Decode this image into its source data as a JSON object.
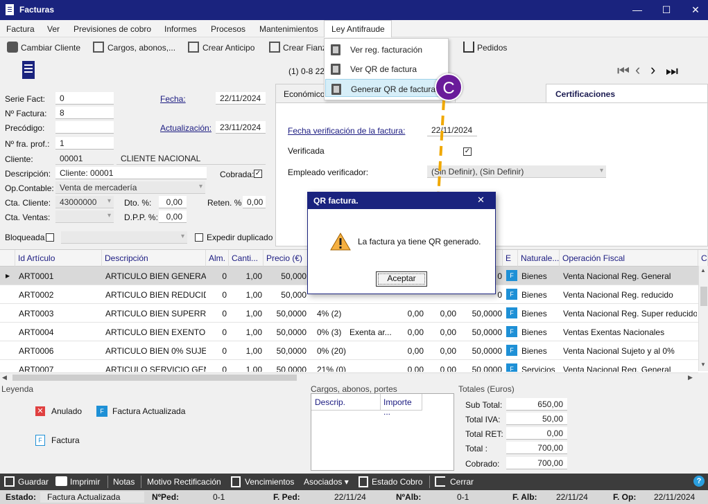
{
  "window": {
    "title": "Facturas",
    "minimize": "—",
    "maximize": "☐",
    "close": "✕"
  },
  "menu": [
    "Factura",
    "Ver",
    "Previsiones de cobro",
    "Informes",
    "Procesos",
    "Mantenimientos",
    "Ley Antifraude"
  ],
  "toolbar": {
    "cambiar_cliente": "Cambiar Cliente",
    "cargos": "Cargos, abonos,...",
    "crear_anticipo": "Crear Anticipo",
    "crear_fianza": "Crear Fianza",
    "pedidos": "Pedidos"
  },
  "dropdown": {
    "items": [
      "Ver reg. facturación",
      "Ver QR de factura",
      "Generar QR de factura"
    ]
  },
  "callout": "C",
  "nav_info": "(1) 0-8  22",
  "form": {
    "serie_label": "Serie Fact:",
    "serie": "0",
    "fecha_label": "Fecha:",
    "fecha": "22/11/2024",
    "nfactura_label": "Nº Factura:",
    "nfactura": "8",
    "actualizacion_label": "Actualización:",
    "actualizacion": "23/11/2024",
    "precodigo_label": "Precódigo:",
    "precodigo": "",
    "nfra_label": "Nº fra. prof.:",
    "nfra": "1",
    "cliente_label": "Cliente:",
    "cliente_code": "00001",
    "cliente_name": "CLIENTE NACIONAL",
    "descripcion_label": "Descripción:",
    "descripcion": "Cliente: 00001",
    "cobrada_label": "Cobrada:",
    "opcontable_label": "Op.Contable:",
    "opcontable": "Venta de mercadería",
    "ctacliente_label": "Cta. Cliente:",
    "ctacliente": "43000000",
    "dto_label": "Dto. %:",
    "dto": "0,00",
    "reten_label": "Reten. %",
    "reten": "0,00",
    "ctaventas_label": "Cta. Ventas:",
    "ctaventas": "",
    "dpp_label": "D.P.P. %:",
    "dpp": "0,00",
    "bloqueada_label": "Bloqueada",
    "expedir_label": "Expedir duplicado"
  },
  "tabs": {
    "economico": "Económico",
    "certificaciones": "Certificaciones"
  },
  "panel": {
    "fecha_verif_label": "Fecha verificación de la factura:",
    "fecha_verif": "22/11/2024",
    "verificada_label": "Verificada",
    "empleado_label": "Empleado verificador:",
    "empleado": "(Sin Definir), (Sin Definir)"
  },
  "grid": {
    "headers": [
      "Id Artículo",
      "Descripción",
      "Alm.",
      "Canti...",
      "Precio (€)",
      "E",
      "Naturale...",
      "Operación Fiscal",
      "C"
    ],
    "rows": [
      {
        "id": "ART0001",
        "desc": "ARTICULO BIEN GENERAL",
        "alm": "0",
        "cant": "1,00",
        "precio": "50,000",
        "iva": "",
        "exenta": "",
        "a": "",
        "b": "",
        "total": "0",
        "nat": "Bienes",
        "op": "Venta Nacional Reg. General"
      },
      {
        "id": "ART0002",
        "desc": "ARTICULO BIEN REDUCIDO",
        "alm": "0",
        "cant": "1,00",
        "precio": "50,000",
        "iva": "",
        "exenta": "",
        "a": "",
        "b": "",
        "total": "0",
        "nat": "Bienes",
        "op": "Venta Nacional Reg. reducido"
      },
      {
        "id": "ART0003",
        "desc": "ARTICULO BIEN SUPERR...",
        "alm": "0",
        "cant": "1,00",
        "precio": "50,0000",
        "iva": "4% (2)",
        "exenta": "",
        "a": "0,00",
        "b": "0,00",
        "total": "50,0000",
        "nat": "Bienes",
        "op": "Venta Nacional Reg. Super reducido"
      },
      {
        "id": "ART0004",
        "desc": "ARTICULO BIEN EXENTO",
        "alm": "0",
        "cant": "1,00",
        "precio": "50,0000",
        "iva": "0% (3)",
        "exenta": "Exenta ar...",
        "a": "0,00",
        "b": "0,00",
        "total": "50,0000",
        "nat": "Bienes",
        "op": "Ventas Exentas Nacionales"
      },
      {
        "id": "ART0006",
        "desc": "ARTICULO BIEN 0% SUJE...",
        "alm": "0",
        "cant": "1,00",
        "precio": "50,0000",
        "iva": "0% (20)",
        "exenta": "",
        "a": "0,00",
        "b": "0,00",
        "total": "50,0000",
        "nat": "Bienes",
        "op": "Venta Nacional Sujeto y al 0%"
      },
      {
        "id": "ART0007",
        "desc": "ARTICULO SERVICIO GEN...",
        "alm": "0",
        "cant": "1,00",
        "precio": "50,0000",
        "iva": "21% (0)",
        "exenta": "",
        "a": "0,00",
        "b": "0,00",
        "total": "50,0000",
        "nat": "Servicios",
        "op": "Venta Nacional Reg. General"
      }
    ],
    "badge": "F"
  },
  "dialog": {
    "title": "QR factura.",
    "message": "La factura ya tiene QR generado.",
    "ok": "Aceptar"
  },
  "legend": {
    "title": "Leyenda",
    "anulado": "Anulado",
    "actualizada": "Factura Actualizada",
    "factura": "Factura"
  },
  "cargos": {
    "title": "Cargos, abonos, portes",
    "col1": "Descrip.",
    "col2": "Importe ..."
  },
  "totales": {
    "title": "Totales (Euros)",
    "subtotal_label": "Sub Total:",
    "subtotal": "650,00",
    "iva_label": "Total IVA:",
    "iva": "50,00",
    "ret_label": "Total RET:",
    "ret": "0,00",
    "total_label": "Total :",
    "total": "700,00",
    "cobrado_label": "Cobrado:",
    "cobrado": "700,00"
  },
  "bottom": {
    "guardar": "Guardar",
    "imprimir": "Imprimir",
    "notas": "Notas",
    "motivo": "Motivo Rectificación",
    "vencimientos": "Vencimientos",
    "asociados": "Asociados ▾",
    "estado_cobro": "Estado Cobro",
    "cerrar": "Cerrar",
    "help": "?"
  },
  "status": {
    "estado_label": "Estado:",
    "estado": "Factura Actualizada",
    "nped_label": "NºPed:",
    "nped": "0-1",
    "fped_label": "F. Ped:",
    "fped": "22/11/24",
    "nalb_label": "NºAlb:",
    "nalb": "0-1",
    "falb_label": "F. Alb:",
    "falb": "22/11/24",
    "fop_label": "F. Op:",
    "fop": "22/11/2024"
  }
}
